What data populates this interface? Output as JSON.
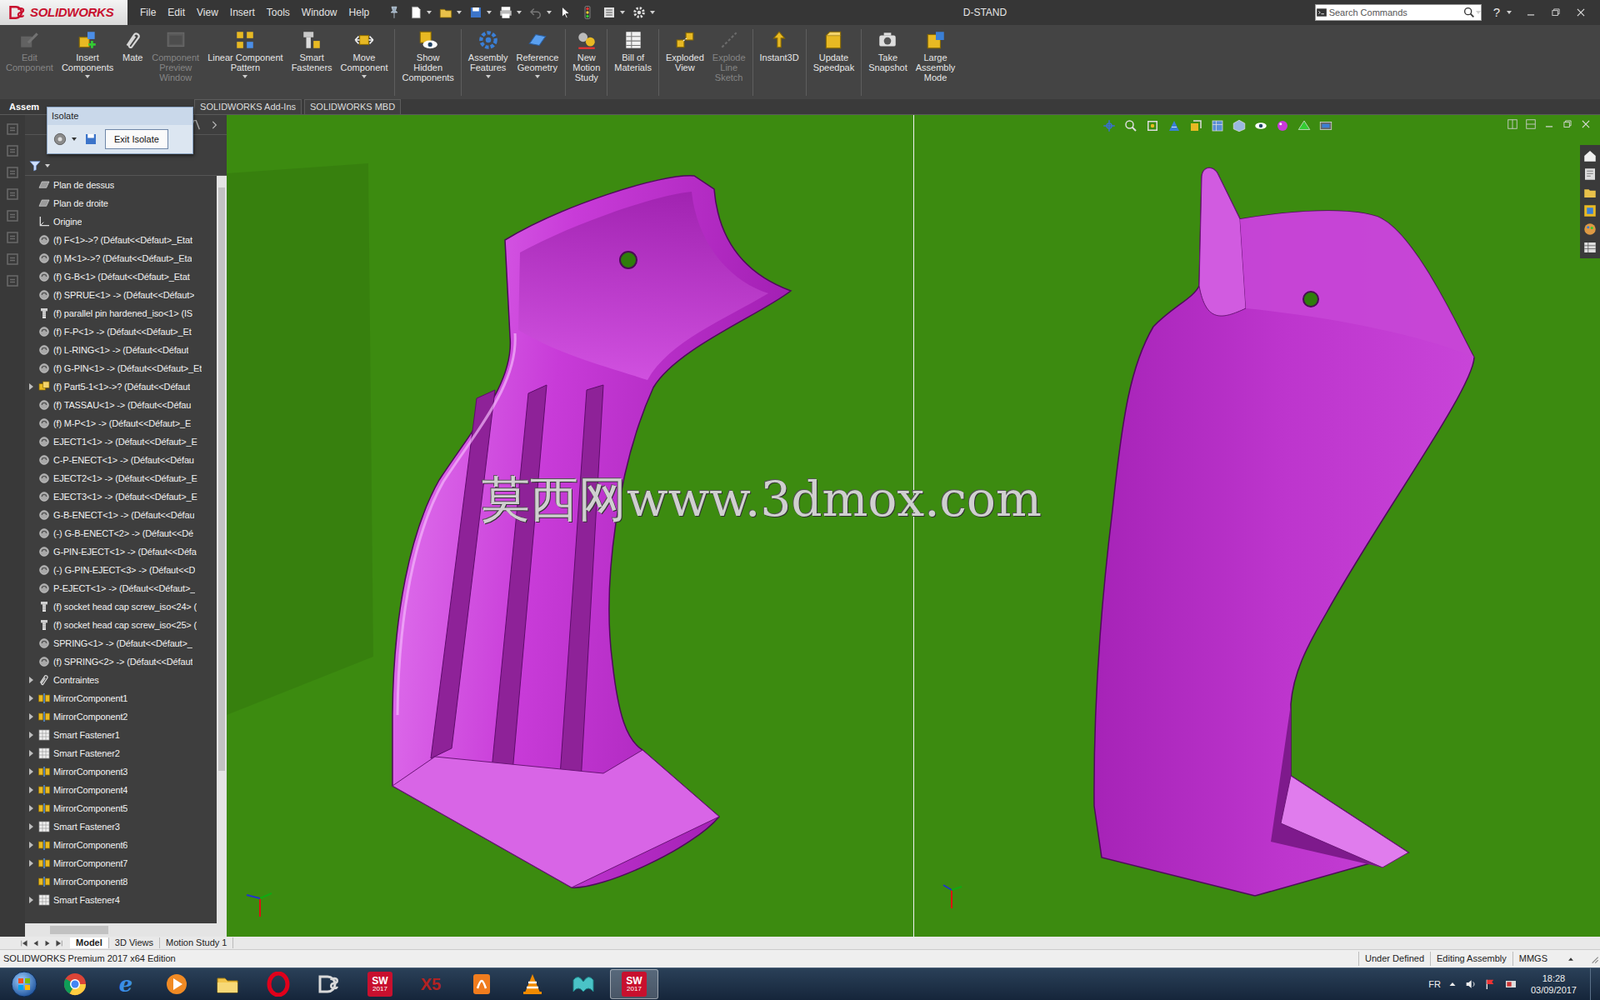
{
  "app": {
    "logo": "SOLIDWORKS",
    "menu": [
      "File",
      "Edit",
      "View",
      "Insert",
      "Tools",
      "Window",
      "Help"
    ],
    "title": "D-STAND",
    "search_placeholder": "Search Commands",
    "help": "?"
  },
  "ribbon": [
    {
      "lines": [
        "Edit",
        "Component"
      ],
      "disabled": true,
      "dropdown": false,
      "group": 1
    },
    {
      "lines": [
        "Insert",
        "Components"
      ],
      "disabled": false,
      "dropdown": true,
      "group": 1
    },
    {
      "lines": [
        "Mate"
      ],
      "disabled": false,
      "dropdown": false,
      "group": 1
    },
    {
      "lines": [
        "Component",
        "Preview",
        "Window"
      ],
      "disabled": true,
      "dropdown": false,
      "group": 1
    },
    {
      "lines": [
        "Linear Component",
        "Pattern"
      ],
      "disabled": false,
      "dropdown": true,
      "group": 1
    },
    {
      "lines": [
        "Smart",
        "Fasteners"
      ],
      "disabled": false,
      "dropdown": false,
      "group": 1
    },
    {
      "lines": [
        "Move",
        "Component"
      ],
      "disabled": false,
      "dropdown": true,
      "group": 1
    },
    {
      "lines": [
        "Show",
        "Hidden",
        "Components"
      ],
      "disabled": false,
      "dropdown": false,
      "group": 2
    },
    {
      "lines": [
        "Assembly",
        "Features"
      ],
      "disabled": false,
      "dropdown": true,
      "group": 3
    },
    {
      "lines": [
        "Reference",
        "Geometry"
      ],
      "disabled": false,
      "dropdown": true,
      "group": 3
    },
    {
      "lines": [
        "New",
        "Motion",
        "Study"
      ],
      "disabled": false,
      "dropdown": false,
      "group": 4
    },
    {
      "lines": [
        "Bill of",
        "Materials"
      ],
      "disabled": false,
      "dropdown": false,
      "group": 5
    },
    {
      "lines": [
        "Exploded",
        "View"
      ],
      "disabled": false,
      "dropdown": false,
      "group": 6
    },
    {
      "lines": [
        "Explode",
        "Line",
        "Sketch"
      ],
      "disabled": true,
      "dropdown": false,
      "group": 6
    },
    {
      "lines": [
        "Instant3D"
      ],
      "disabled": false,
      "dropdown": false,
      "group": 7
    },
    {
      "lines": [
        "Update",
        "Speedpak"
      ],
      "disabled": false,
      "dropdown": false,
      "group": 8
    },
    {
      "lines": [
        "Take",
        "Snapshot"
      ],
      "disabled": false,
      "dropdown": false,
      "group": 9
    },
    {
      "lines": [
        "Large",
        "Assembly",
        "Mode"
      ],
      "disabled": false,
      "dropdown": false,
      "group": 9
    }
  ],
  "command_tabs": [
    {
      "label": "Assem",
      "selected": true
    },
    {
      "label": "SOLIDWORKS Add-Ins",
      "selected": false
    },
    {
      "label": "SOLIDWORKS MBD",
      "selected": false
    }
  ],
  "isolate": {
    "title": "Isolate",
    "button": "Exit Isolate"
  },
  "tree": [
    {
      "label": "Plan de dessus",
      "kind": "plane",
      "expandable": false
    },
    {
      "label": "Plan de droite",
      "kind": "plane",
      "expandable": false
    },
    {
      "label": "Origine",
      "kind": "origin",
      "expandable": false
    },
    {
      "label": "(f) F<1>->? (Défaut<<Défaut>_Etat",
      "kind": "part",
      "expandable": false
    },
    {
      "label": "(f) M<1>->? (Défaut<<Défaut>_Eta",
      "kind": "part",
      "expandable": false
    },
    {
      "label": "(f) G-B<1> (Défaut<<Défaut>_Etat",
      "kind": "part",
      "expandable": false
    },
    {
      "label": "(f) SPRUE<1> -> (Défaut<<Défaut>",
      "kind": "part",
      "expandable": false
    },
    {
      "label": "(f) parallel pin hardened_iso<1> (IS",
      "kind": "fastener",
      "expandable": false
    },
    {
      "label": "(f) F-P<1> -> (Défaut<<Défaut>_Et",
      "kind": "part",
      "expandable": false
    },
    {
      "label": "(f) L-RING<1> -> (Défaut<<Défaut",
      "kind": "part",
      "expandable": false
    },
    {
      "label": "(f) G-PIN<1> -> (Défaut<<Défaut>_Et",
      "kind": "part",
      "expandable": false
    },
    {
      "label": "(f) Part5-1<1>->? (Défaut<<Défaut",
      "kind": "subassembly",
      "expandable": true
    },
    {
      "label": "(f) TASSAU<1> -> (Défaut<<Défau",
      "kind": "part",
      "expandable": false
    },
    {
      "label": "(f) M-P<1> -> (Défaut<<Défaut>_E",
      "kind": "part",
      "expandable": false
    },
    {
      "label": "EJECT1<1> -> (Défaut<<Défaut>_E",
      "kind": "part",
      "expandable": false
    },
    {
      "label": "C-P-ENECT<1> -> (Défaut<<Défau",
      "kind": "part",
      "expandable": false
    },
    {
      "label": "EJECT2<1> -> (Défaut<<Défaut>_E",
      "kind": "part",
      "expandable": false
    },
    {
      "label": "EJECT3<1> -> (Défaut<<Défaut>_E",
      "kind": "part",
      "expandable": false
    },
    {
      "label": "G-B-ENECT<1> -> (Défaut<<Défau",
      "kind": "part",
      "expandable": false
    },
    {
      "label": "(-) G-B-ENECT<2> -> (Défaut<<Dé",
      "kind": "part",
      "expandable": false
    },
    {
      "label": "G-PIN-EJECT<1> -> (Défaut<<Défa",
      "kind": "part",
      "expandable": false
    },
    {
      "label": "(-) G-PIN-EJECT<3> -> (Défaut<<D",
      "kind": "part",
      "expandable": false
    },
    {
      "label": "P-EJECT<1> -> (Défaut<<Défaut>_",
      "kind": "part",
      "expandable": false
    },
    {
      "label": "(f) socket head cap screw_iso<24> (",
      "kind": "fastener",
      "expandable": false
    },
    {
      "label": "(f) socket head cap screw_iso<25> (",
      "kind": "fastener",
      "expandable": false
    },
    {
      "label": "SPRING<1> -> (Défaut<<Défaut>_",
      "kind": "part",
      "expandable": false
    },
    {
      "label": "(f) SPRING<2> -> (Défaut<<Défaut",
      "kind": "part",
      "expandable": false
    },
    {
      "label": "Contraintes",
      "kind": "mates",
      "expandable": true
    },
    {
      "label": "MirrorComponent1",
      "kind": "mirror",
      "expandable": true
    },
    {
      "label": "MirrorComponent2",
      "kind": "mirror",
      "expandable": true
    },
    {
      "label": "Smart Fastener1",
      "kind": "smart-fastener",
      "expandable": true
    },
    {
      "label": "Smart Fastener2",
      "kind": "smart-fastener",
      "expandable": true
    },
    {
      "label": "MirrorComponent3",
      "kind": "mirror",
      "expandable": true
    },
    {
      "label": "MirrorComponent4",
      "kind": "mirror",
      "expandable": true
    },
    {
      "label": "MirrorComponent5",
      "kind": "mirror",
      "expandable": true
    },
    {
      "label": "Smart Fastener3",
      "kind": "smart-fastener",
      "expandable": true
    },
    {
      "label": "MirrorComponent6",
      "kind": "mirror",
      "expandable": true
    },
    {
      "label": "MirrorComponent7",
      "kind": "mirror",
      "expandable": true
    },
    {
      "label": "MirrorComponent8",
      "kind": "mirror",
      "expandable": false
    },
    {
      "label": "Smart Fastener4",
      "kind": "smart-fastener",
      "expandable": true
    }
  ],
  "watermark": "莫西网www.3dmox.com",
  "bottom_tabs": [
    {
      "label": "Model",
      "selected": true
    },
    {
      "label": "3D Views",
      "selected": false
    },
    {
      "label": "Motion Study 1",
      "selected": false
    }
  ],
  "status_bar": {
    "edition": "SOLIDWORKS Premium 2017 x64 Edition",
    "items": [
      "Under Defined",
      "Editing Assembly",
      "MMGS"
    ]
  },
  "taskbar": {
    "apps": [
      {
        "kind": "start",
        "active": false
      },
      {
        "kind": "chrome",
        "active": false
      },
      {
        "kind": "ie",
        "text": "e",
        "active": false
      },
      {
        "kind": "media",
        "active": false
      },
      {
        "kind": "folder",
        "active": false
      },
      {
        "kind": "opera",
        "active": false
      },
      {
        "kind": "ds",
        "active": false
      },
      {
        "kind": "sw",
        "text": "SW",
        "sub": "2017",
        "active": false
      },
      {
        "kind": "xara",
        "text": "X5",
        "active": false
      },
      {
        "kind": "pdf",
        "active": false
      },
      {
        "kind": "vlc",
        "active": false
      },
      {
        "kind": "maps",
        "active": false
      },
      {
        "kind": "sw",
        "text": "SW",
        "sub": "2017",
        "active": true
      }
    ],
    "language": "FR",
    "time": "18:28",
    "date": "03/09/2017"
  }
}
